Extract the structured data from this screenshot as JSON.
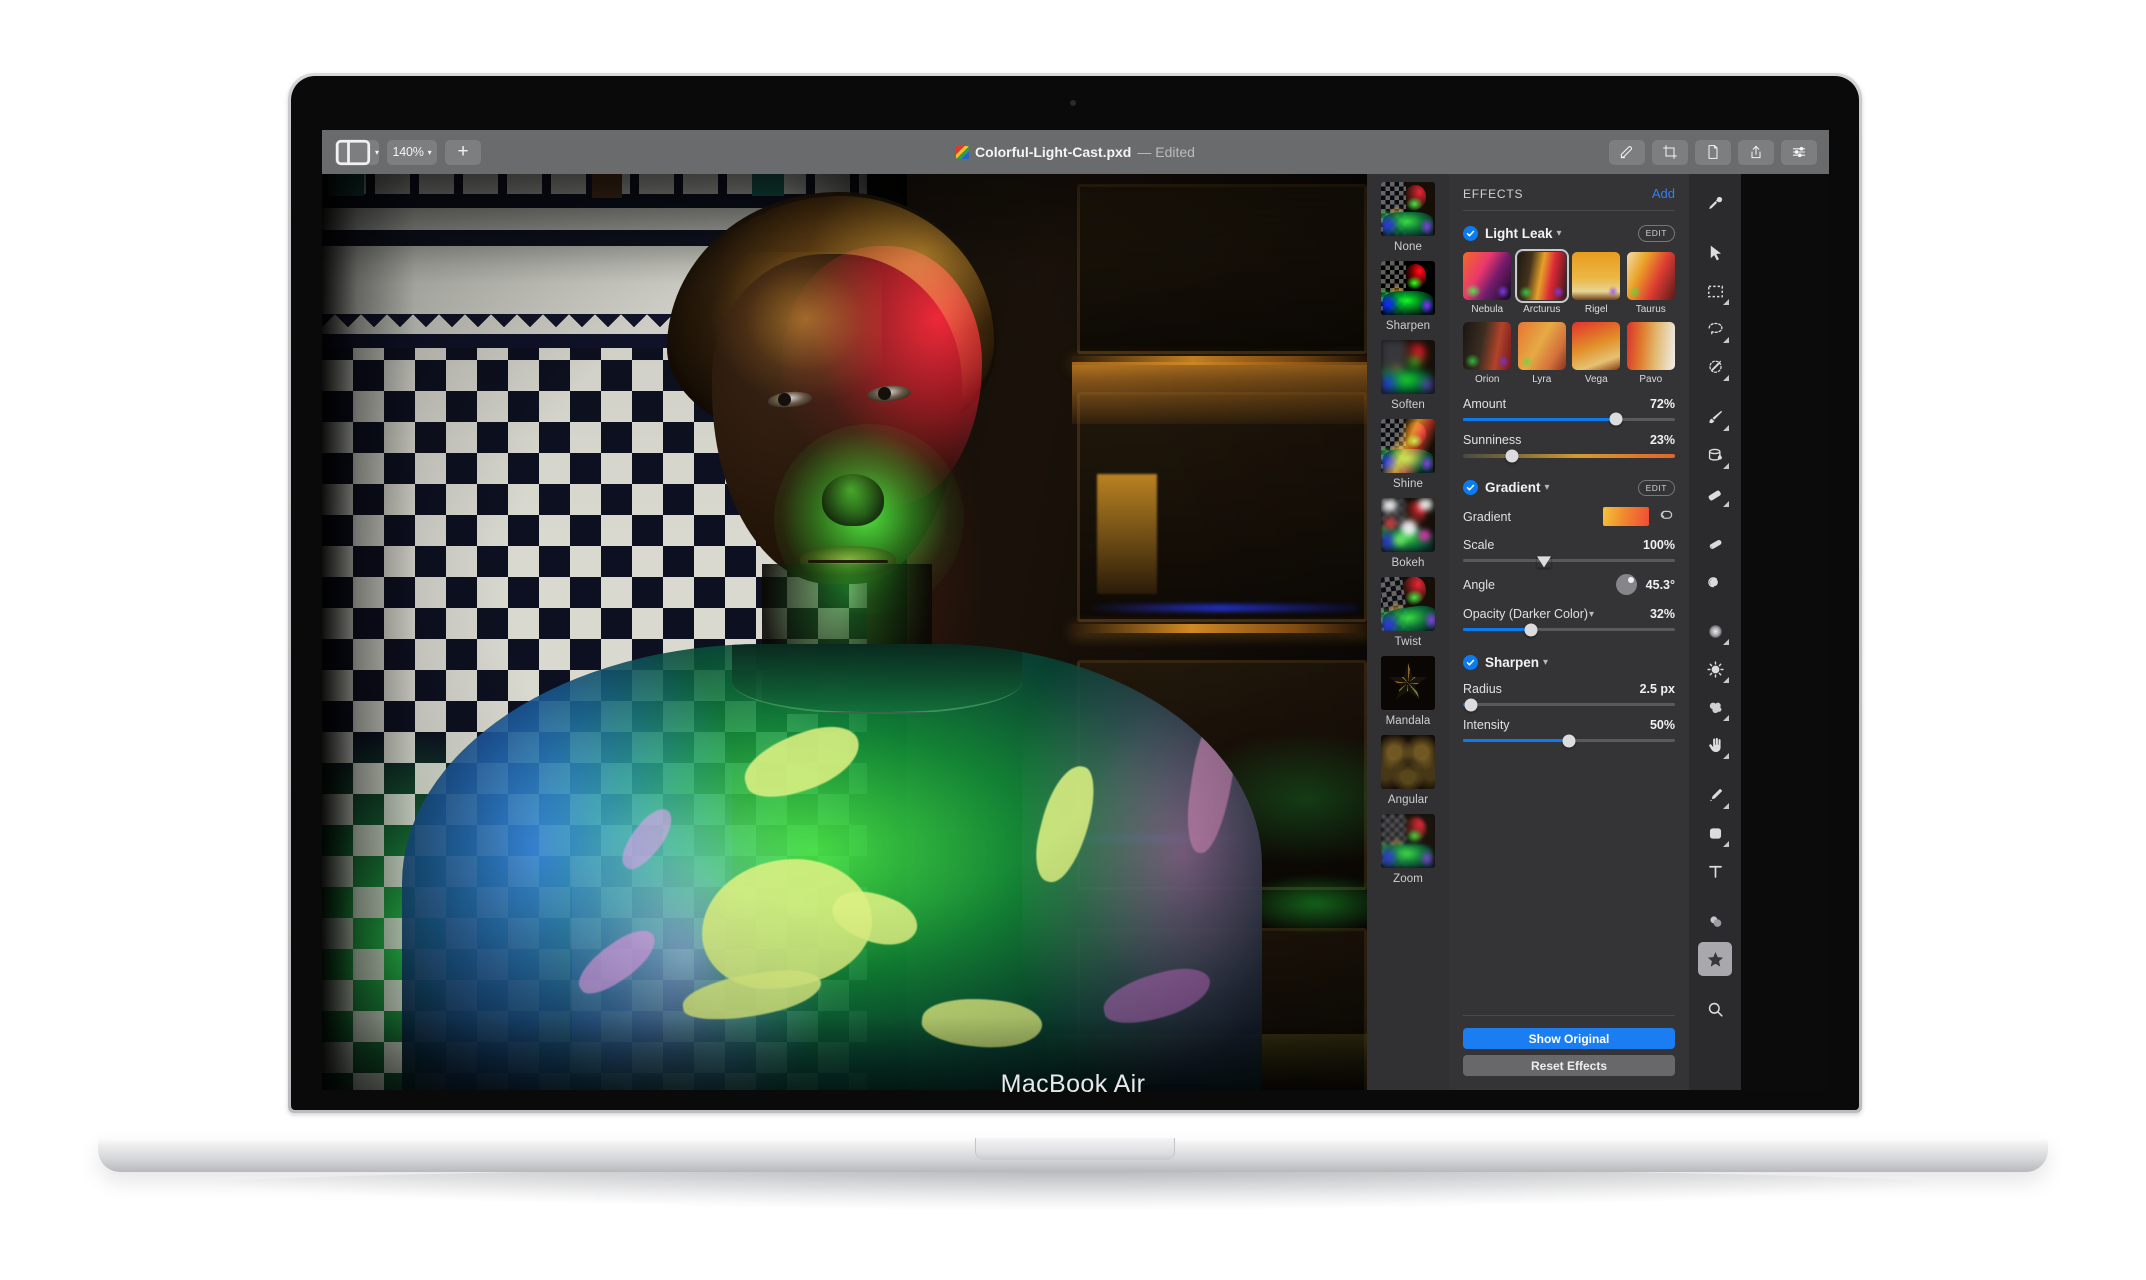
{
  "device": {
    "model_label": "MacBook Air"
  },
  "titlebar": {
    "layout_label": "",
    "zoom_level": "140%",
    "add_label": "+",
    "document_name": "Colorful-Light-Cast.pxd",
    "edited_status": "— Edited",
    "right_tools": [
      {
        "name": "retouch-icon",
        "tooltip": "Retouch"
      },
      {
        "name": "crop-icon",
        "tooltip": "Crop"
      },
      {
        "name": "document-icon",
        "tooltip": "Document"
      },
      {
        "name": "share-icon",
        "tooltip": "Share"
      },
      {
        "name": "adjust-icon",
        "tooltip": "Adjustments"
      }
    ]
  },
  "presets": {
    "items": [
      {
        "label": "None"
      },
      {
        "label": "Sharpen"
      },
      {
        "label": "Soften"
      },
      {
        "label": "Shine"
      },
      {
        "label": "Bokeh"
      },
      {
        "label": "Twist"
      },
      {
        "label": "Mandala"
      },
      {
        "label": "Angular"
      },
      {
        "label": "Zoom"
      }
    ]
  },
  "effects_panel": {
    "title": "EFFECTS",
    "add_label": "Add",
    "edit_label": "EDIT",
    "groups": {
      "light_leak": {
        "name": "Light Leak",
        "enabled": true,
        "presets": [
          {
            "label": "Nebula",
            "selected": false
          },
          {
            "label": "Arcturus",
            "selected": true
          },
          {
            "label": "Rigel",
            "selected": false
          },
          {
            "label": "Taurus",
            "selected": false
          },
          {
            "label": "Orion",
            "selected": false
          },
          {
            "label": "Lyra",
            "selected": false
          },
          {
            "label": "Vega",
            "selected": false
          },
          {
            "label": "Pavo",
            "selected": false
          }
        ],
        "sliders": [
          {
            "label": "Amount",
            "value": "72%",
            "percent": 72
          },
          {
            "label": "Sunniness",
            "value": "23%",
            "percent": 23
          }
        ]
      },
      "gradient": {
        "name": "Gradient",
        "enabled": true,
        "gradient_label": "Gradient",
        "gradient_colors": [
          "#f4c43a",
          "#f08a2e",
          "#ef4b36"
        ],
        "loop_icon": "loop-icon",
        "scale": {
          "label": "Scale",
          "value": "100%",
          "percent": 38
        },
        "angle": {
          "label": "Angle",
          "value": "45.3°"
        },
        "opacity": {
          "label": "Opacity (Darker Color)",
          "value": "32%",
          "percent": 32
        }
      },
      "sharpen": {
        "name": "Sharpen",
        "enabled": true,
        "sliders": [
          {
            "label": "Radius",
            "value": "2.5 px",
            "percent": 4
          },
          {
            "label": "Intensity",
            "value": "50%",
            "percent": 50
          }
        ]
      }
    },
    "footer": {
      "show_original": "Show Original",
      "reset_effects": "Reset Effects"
    }
  },
  "toolbar": {
    "tools": [
      {
        "name": "clone-stamp-icon",
        "selected": false
      },
      {
        "name": "arrow-select-icon",
        "selected": false
      },
      {
        "name": "marquee-select-icon",
        "selected": false
      },
      {
        "name": "lasso-select-icon",
        "selected": false
      },
      {
        "name": "magic-wand-icon",
        "selected": false
      },
      {
        "name": "paint-brush-icon",
        "selected": false
      },
      {
        "name": "paint-bucket-icon",
        "selected": false
      },
      {
        "name": "eraser-icon",
        "selected": false
      },
      {
        "name": "smudge-icon",
        "selected": false
      },
      {
        "name": "clone-icon",
        "selected": false
      },
      {
        "name": "blur-icon",
        "selected": false
      },
      {
        "name": "brightness-icon",
        "selected": false
      },
      {
        "name": "sponge-icon",
        "selected": false
      },
      {
        "name": "hand-icon",
        "selected": false
      },
      {
        "name": "pen-icon",
        "selected": false
      },
      {
        "name": "shape-icon",
        "selected": false
      },
      {
        "name": "text-icon",
        "selected": false
      },
      {
        "name": "blend-icon",
        "selected": false
      },
      {
        "name": "effects-star-icon",
        "selected": true
      },
      {
        "name": "zoom-search-icon",
        "selected": false
      }
    ]
  },
  "colors": {
    "accent_blue": "#0a7cf0",
    "panel_bg": "#343436",
    "presets_bg": "#313133",
    "titlebar_bg": "#6a6b6d",
    "button_primary": "#1a7ef2",
    "button_secondary": "#68686b"
  }
}
